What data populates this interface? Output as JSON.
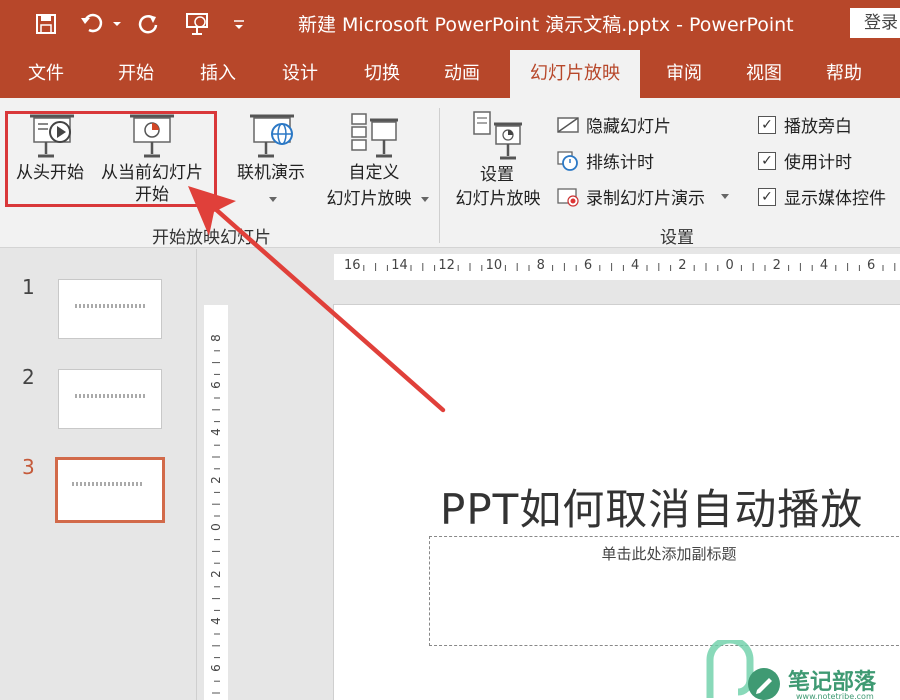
{
  "window": {
    "title": "新建 Microsoft PowerPoint 演示文稿.pptx - PowerPoint",
    "login_label": "登录"
  },
  "tabs": [
    {
      "label": "文件"
    },
    {
      "label": "开始"
    },
    {
      "label": "插入"
    },
    {
      "label": "设计"
    },
    {
      "label": "切换"
    },
    {
      "label": "动画"
    },
    {
      "label": "幻灯片放映"
    },
    {
      "label": "审阅"
    },
    {
      "label": "视图"
    },
    {
      "label": "帮助"
    }
  ],
  "ribbon": {
    "from_beginning": "从头开始",
    "from_current_line1": "从当前幻灯片",
    "from_current_line2": "开始",
    "online_present": "联机演示",
    "custom_line1": "自定义",
    "custom_line2": "幻灯片放映",
    "group_start": "开始放映幻灯片",
    "setup_line1": "设置",
    "setup_line2": "幻灯片放映",
    "hide_slide": "隐藏幻灯片",
    "rehearse": "排练计时",
    "record": "录制幻灯片演示",
    "play_narration": "播放旁白",
    "use_timings": "使用计时",
    "show_media": "显示媒体控件",
    "group_setup": "设置"
  },
  "slides": [
    {
      "number": "1"
    },
    {
      "number": "2"
    },
    {
      "number": "3"
    }
  ],
  "rulers": {
    "h_labels": [
      "16",
      "14",
      "12",
      "10",
      "8",
      "6",
      "4",
      "2",
      "0",
      "2",
      "4",
      "6"
    ],
    "v_labels": [
      "8",
      "6",
      "4",
      "2",
      "0",
      "2",
      "4",
      "6"
    ]
  },
  "slide": {
    "title": "PPT如何取消自动播放",
    "subtitle_placeholder": "单击此处添加副标题"
  },
  "watermark": {
    "text": "笔记部落",
    "url": "www.notetribe.com"
  }
}
